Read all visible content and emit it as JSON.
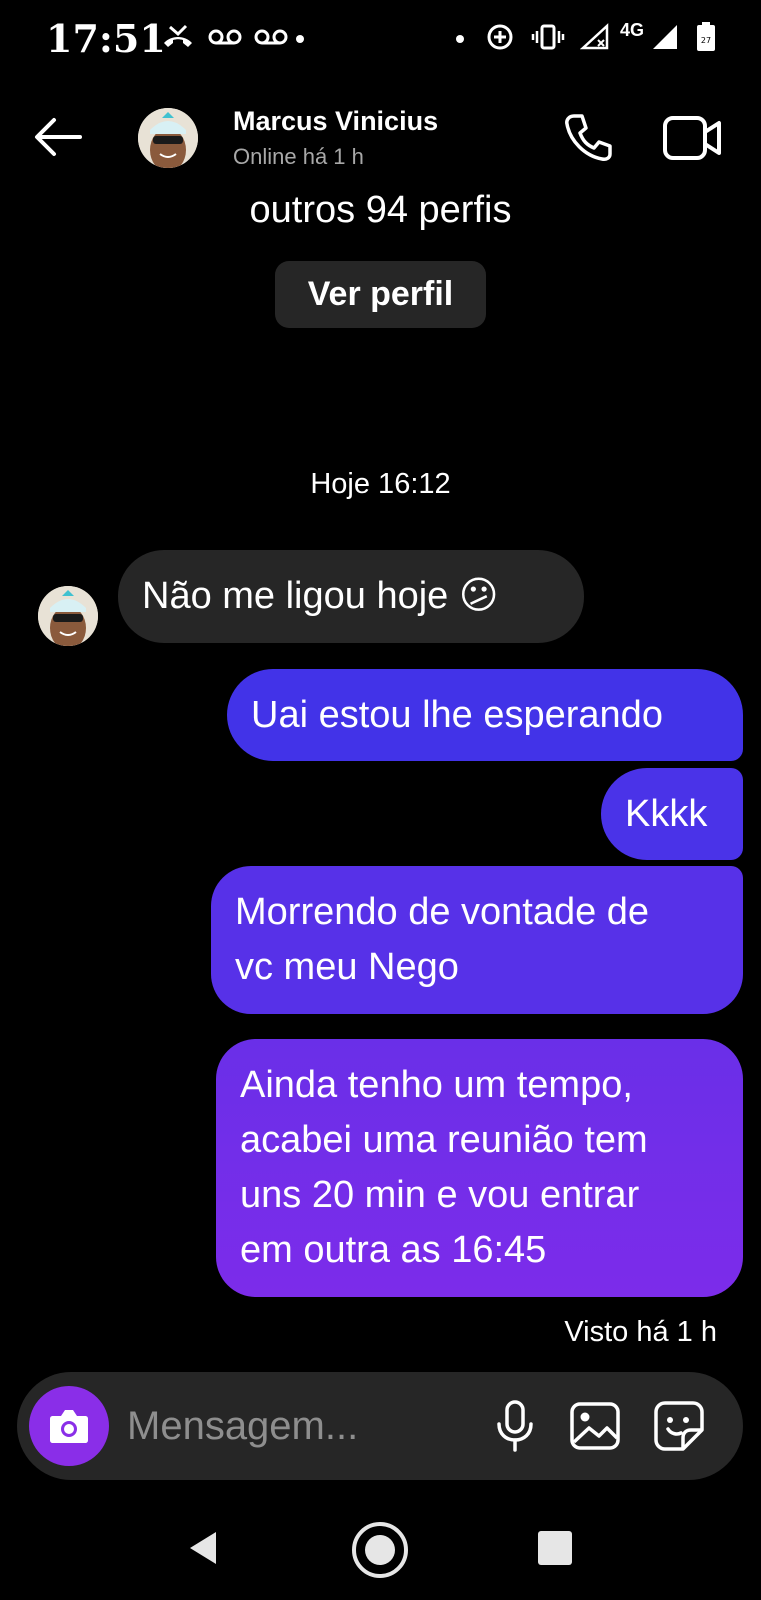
{
  "status_bar": {
    "time": "17:51",
    "network_label": "4G",
    "battery_level": "27",
    "icons": [
      "missed-call-icon",
      "voicemail-icon",
      "voicemail-icon",
      "add-circle-icon",
      "vibrate-icon",
      "signal-no-data-icon",
      "signal-icon",
      "battery-icon"
    ]
  },
  "header": {
    "contact_name": "Marcus Vinicius",
    "contact_status": "Online há 1 h"
  },
  "profile_card": {
    "text": "outros 94 perfis",
    "view_profile_label": "Ver perfil"
  },
  "conversation": {
    "date_separator": "Hoje 16:12",
    "messages": [
      {
        "direction": "incoming",
        "text": "Não me ligou hoje 😕"
      },
      {
        "direction": "outgoing",
        "text": "Uai estou lhe esperando"
      },
      {
        "direction": "outgoing",
        "text": "Kkkk"
      },
      {
        "direction": "outgoing",
        "text": "Morrendo de vontade de\nvc meu Nego"
      },
      {
        "direction": "outgoing",
        "text": "Ainda tenho um tempo,\nacabei uma reunião tem\nuns 20 min e vou entrar\nem outra as 16:45"
      }
    ],
    "seen_status": "Visto há 1 h"
  },
  "composer": {
    "placeholder": "Mensagem..."
  },
  "colors": {
    "background": "#000000",
    "incoming_bubble": "#262626",
    "outgoing_bubble_top": "#4233e8",
    "outgoing_bubble_bottom": "#7c2cea",
    "camera_button": "#8a2ee8"
  }
}
